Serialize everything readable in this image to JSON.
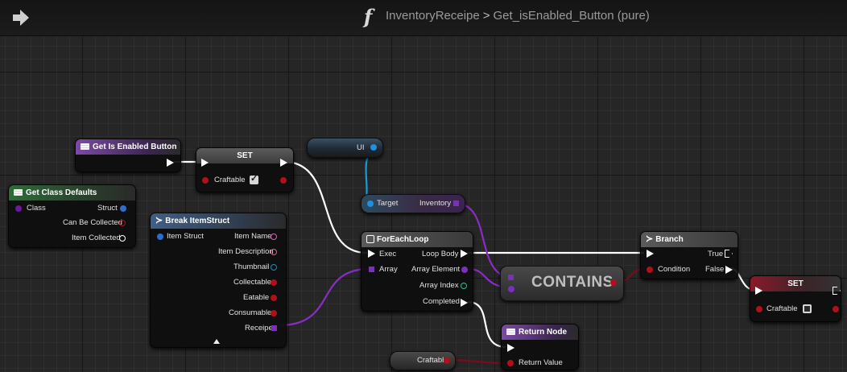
{
  "header": {
    "function_icon": "f",
    "breadcrumb_parent": "InventoryReceipe",
    "breadcrumb_separator": ">",
    "breadcrumb_current": "Get_isEnabled_Button (pure)"
  },
  "nodes": {
    "entry": {
      "title": "Get Is Enabled Button"
    },
    "set_top": {
      "title": "SET",
      "pin_label": "Craftable",
      "checked": true
    },
    "ui_var": {
      "label": "UI"
    },
    "target_node": {
      "in_label": "Target",
      "out_label": "Inventory"
    },
    "class_defaults": {
      "title": "Get Class Defaults",
      "in_label": "Class",
      "outputs": [
        "Struct",
        "Can Be Collected",
        "Item Collected"
      ]
    },
    "break_struct": {
      "title": "Break ItemStruct",
      "in_label": "Item Struct",
      "outputs": [
        "Item Name",
        "Item Description",
        "Thumbnail",
        "Collectable",
        "Eatable",
        "Consumable",
        "Receipe"
      ]
    },
    "foreach": {
      "title": "ForEachLoop",
      "inputs": [
        "Exec",
        "Array"
      ],
      "outputs": [
        "Loop Body",
        "Array Element",
        "Array Index",
        "Completed"
      ]
    },
    "contains": {
      "label": "CONTAINS"
    },
    "branch": {
      "title": "Branch",
      "in_label": "Condition",
      "outputs": [
        "True",
        "False"
      ]
    },
    "set_right": {
      "title": "SET",
      "pin_label": "Craftable",
      "checked": false
    },
    "return_node": {
      "title": "Return Node",
      "in_label": "Return Value"
    },
    "craftable_var": {
      "label": "Craftable"
    }
  },
  "colors": {
    "exec": "#ffffff",
    "object": "#1f8fe0",
    "boolean": "#b0101a",
    "struct": "#2a6fd0",
    "class": "#6a1aa0",
    "array_struct": "#7b2fc0",
    "integer": "#19c898",
    "texture": "#1a8fc8",
    "wire_object": "#1a9ad8",
    "wire_array": "#8a2cc8",
    "wire_bool": "#7a0d18"
  },
  "icons": {
    "back": "arrow-icon",
    "function": "function-icon",
    "node_header": "function-node-icon",
    "struct_break": "break-struct-icon",
    "loop": "loop-icon",
    "branch": "branch-icon"
  }
}
